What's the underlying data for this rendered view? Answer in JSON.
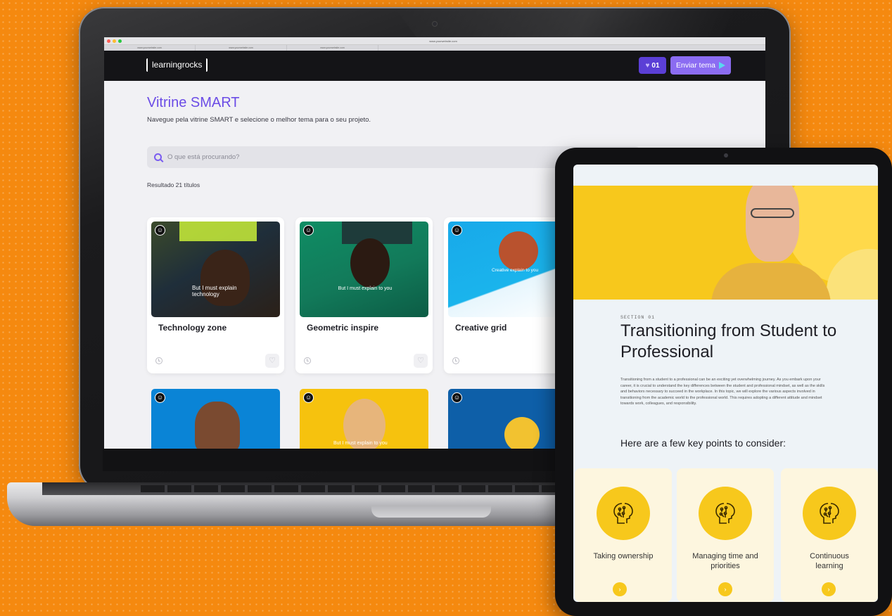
{
  "laptop": {
    "browser": {
      "address": "www.yourwebsite.com",
      "tabs": [
        "www.yourwebsite.com",
        "www.yourwebsite.com",
        "www.yourwebsite.com"
      ]
    },
    "header": {
      "logo": "learningrocks",
      "likes_count": "01",
      "send_label": "Enviar tema"
    },
    "main": {
      "title": "Vitrine SMART",
      "subtitle": "Navegue pela vitrine SMART e selecione o melhor tema para o seu projeto.",
      "search_placeholder": "O que está procurando?",
      "result_count": "Resultado 21 títulos",
      "cards": [
        {
          "title": "Technology zone",
          "thumb_text": "But I must explain technology",
          "thumb_color": "#1f2e3a"
        },
        {
          "title": "Geometric inspire",
          "thumb_text": "But I must explain to you",
          "thumb_color": "#127a5a"
        },
        {
          "title": "Creative grid",
          "thumb_text": "Creative explain to you",
          "thumb_color": "#1ab4ec"
        }
      ],
      "row2_thumbs": [
        {
          "color": "#0a84d6",
          "text": ""
        },
        {
          "color": "#f6c20e",
          "text": "But I must explain to you"
        },
        {
          "color": "#0e5fa8",
          "text": ""
        }
      ]
    }
  },
  "tablet": {
    "section_tag": "SECTION 01",
    "title": "Transitioning from Student to Professional",
    "body": "Transitioning from a student to a professional can be an exciting yet overwhelming journey. As you embark upon your career, it is crucial to understand the key differences between the student and professional mindset, as well as the skills and behaviors necessary to succeed in the workplace. In this topic, we will explore the various aspects involved in transitioning from the academic world to the professional world. This requires adopting a different attitude and mindset towards work, colleagues, and responsibility.",
    "points_heading": "Here are a few key points to consider:",
    "points": [
      {
        "label": "Taking ownership",
        "icon": "brain-icon"
      },
      {
        "label": "Managing time and priorities",
        "icon": "brain-icon"
      },
      {
        "label": "Continuous learning",
        "icon": "brain-icon"
      }
    ]
  },
  "colors": {
    "background": "#f5890f",
    "accent_purple": "#6b4ce6",
    "accent_yellow": "#f7c81c"
  }
}
